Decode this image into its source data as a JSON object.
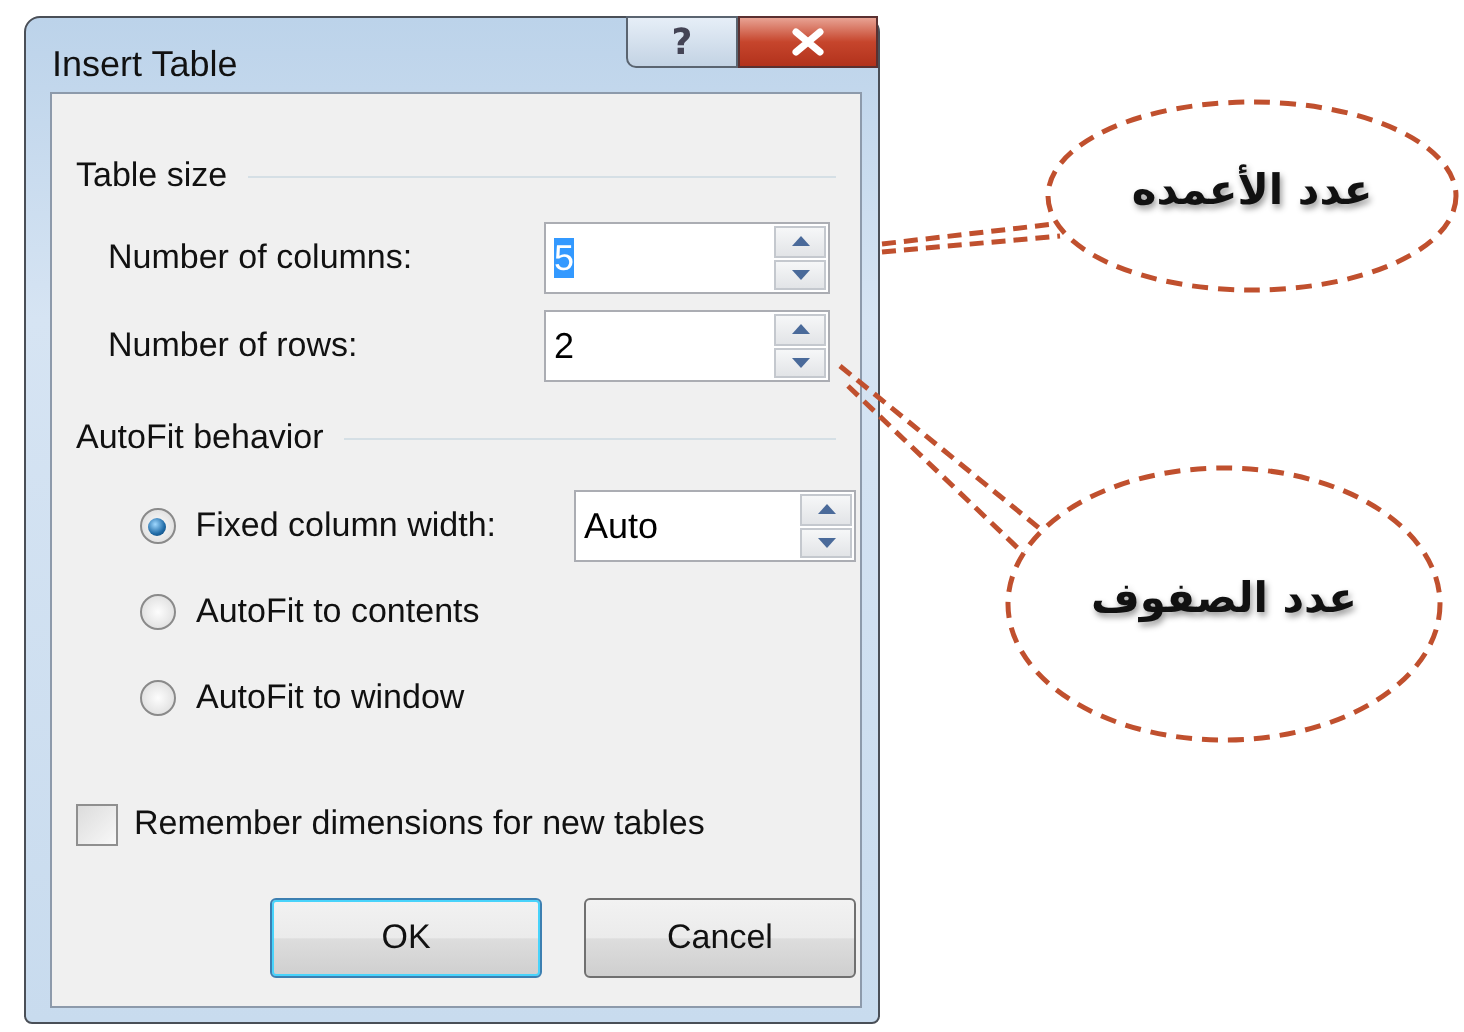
{
  "window": {
    "title": "Insert Table",
    "help_glyph": "?"
  },
  "table_size": {
    "title": "Table size",
    "fields": [
      {
        "label": "Number of columns:",
        "value": "5",
        "text_selected": true
      },
      {
        "label": "Number of rows:",
        "value": "2",
        "text_selected": false
      }
    ]
  },
  "autofit": {
    "title": "AutoFit behavior",
    "options": [
      {
        "label": "Fixed column width:",
        "selected": true,
        "field": {
          "value": "Auto"
        }
      },
      {
        "label": "AutoFit to contents",
        "selected": false
      },
      {
        "label": "AutoFit to window",
        "selected": false
      }
    ]
  },
  "remember": {
    "label": "Remember dimensions for new tables",
    "checked": false
  },
  "buttons": [
    {
      "label": "OK",
      "default": true
    },
    {
      "label": "Cancel",
      "default": false
    }
  ],
  "callouts": [
    {
      "text": "عدد الأعمده"
    },
    {
      "text": "عدد الصفوف"
    }
  ]
}
